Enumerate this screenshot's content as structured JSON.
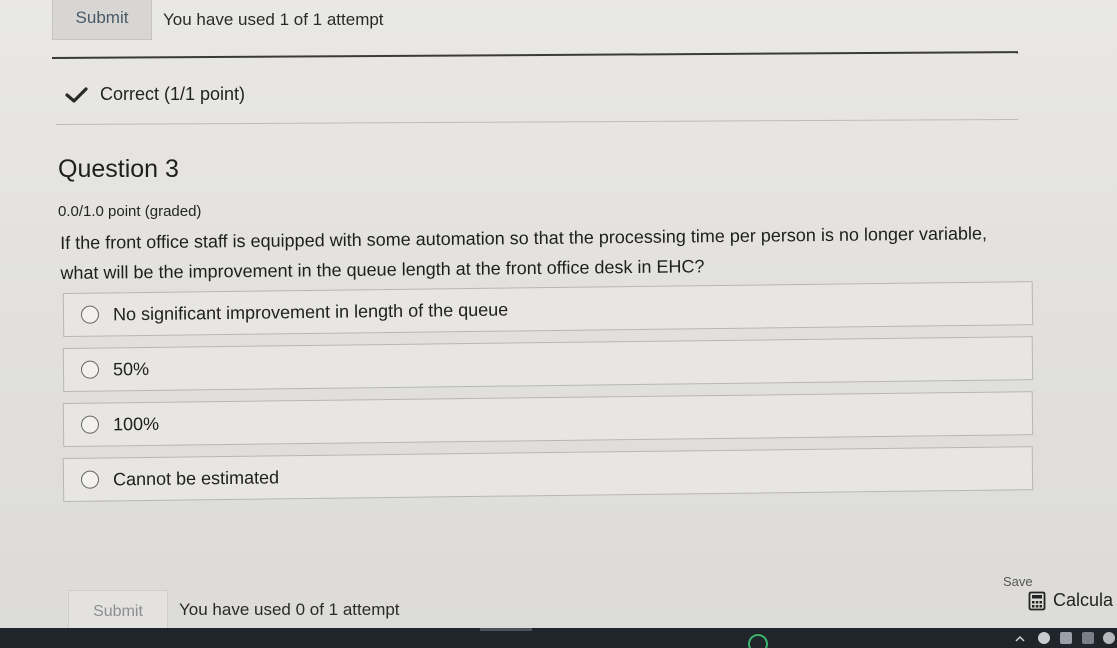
{
  "header": {
    "submit_label": "Submit",
    "attempts_text": "You have used 1 of 1 attempt"
  },
  "previous_result": {
    "status_icon": "check-icon",
    "text": "Correct (1/1 point)"
  },
  "question": {
    "title": "Question 3",
    "score": "0.0/1.0 point (graded)",
    "prompt": "If the front office staff is equipped with some automation so that the processing time per person is no longer variable, what will be the improvement in the queue length at the front office desk in EHC?",
    "options": [
      {
        "label": "No significant improvement in length of the queue",
        "selected": false
      },
      {
        "label": "50%",
        "selected": false
      },
      {
        "label": "100%",
        "selected": false
      },
      {
        "label": "Cannot be estimated",
        "selected": false
      }
    ]
  },
  "footer": {
    "submit_label": "Submit",
    "attempts_text": "You have used 0 of 1 attempt",
    "save_label": "Save",
    "calculator_label": "Calcula",
    "calculator_icon": "calculator-icon"
  },
  "colors": {
    "background": "#e4e3df",
    "text": "#2b2b2b",
    "disabled_text": "#8a8f95",
    "taskbar": "#20242b"
  }
}
